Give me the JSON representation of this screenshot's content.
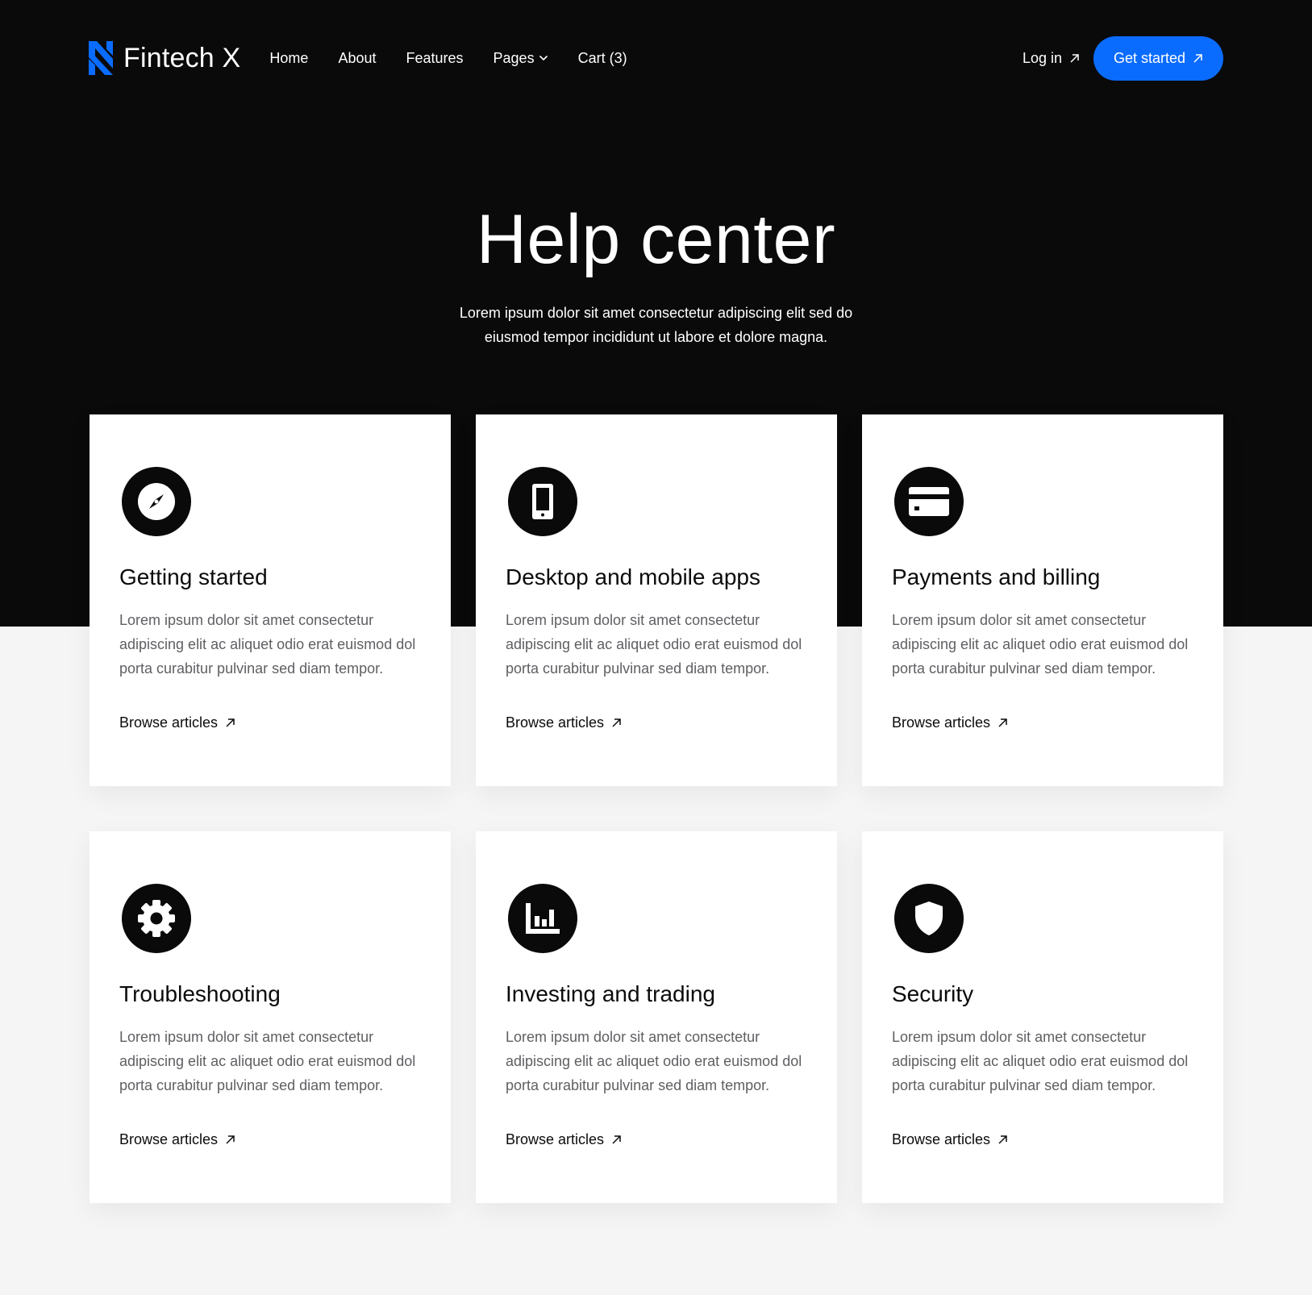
{
  "brand": {
    "name": "Fintech X",
    "logo_icon": "fintech-x-logo"
  },
  "nav": {
    "items": [
      {
        "label": "Home"
      },
      {
        "label": "About"
      },
      {
        "label": "Features"
      },
      {
        "label": "Pages"
      },
      {
        "label": "Cart (3)"
      }
    ]
  },
  "header": {
    "login_label": "Log in",
    "cta_label": "Get started"
  },
  "hero": {
    "title": "Help center",
    "subtitle": "Lorem ipsum dolor sit amet consectetur adipiscing elit sed do eiusmod tempor incididunt ut labore et dolore magna."
  },
  "colors": {
    "accent": "#0a6cff",
    "dark": "#0a0a0a",
    "light_bg": "#f5f5f5",
    "body_text": "#5f5f63"
  },
  "cards": [
    {
      "icon": "compass-icon",
      "title": "Getting started",
      "text": "Lorem ipsum dolor sit amet consectetur adipiscing elit ac aliquet odio erat euismod dol porta curabitur pulvinar sed diam tempor.",
      "link": "Browse articles"
    },
    {
      "icon": "mobile-icon",
      "title": "Desktop and mobile apps",
      "text": "Lorem ipsum dolor sit amet consectetur adipiscing elit ac aliquet odio erat euismod dol porta curabitur pulvinar sed diam tempor.",
      "link": "Browse articles"
    },
    {
      "icon": "credit-card-icon",
      "title": "Payments and billing",
      "text": "Lorem ipsum dolor sit amet consectetur adipiscing elit ac aliquet odio erat euismod dol porta curabitur pulvinar sed diam tempor.",
      "link": "Browse articles"
    },
    {
      "icon": "gear-icon",
      "title": "Troubleshooting",
      "text": "Lorem ipsum dolor sit amet consectetur adipiscing elit ac aliquet odio erat euismod dol porta curabitur pulvinar sed diam tempor.",
      "link": "Browse articles"
    },
    {
      "icon": "bar-chart-icon",
      "title": "Investing and trading",
      "text": "Lorem ipsum dolor sit amet consectetur adipiscing elit ac aliquet odio erat euismod dol porta curabitur pulvinar sed diam tempor.",
      "link": "Browse articles"
    },
    {
      "icon": "shield-icon",
      "title": "Security",
      "text": "Lorem ipsum dolor sit amet consectetur adipiscing elit ac aliquet odio erat euismod dol porta curabitur pulvinar sed diam tempor.",
      "link": "Browse articles"
    }
  ]
}
